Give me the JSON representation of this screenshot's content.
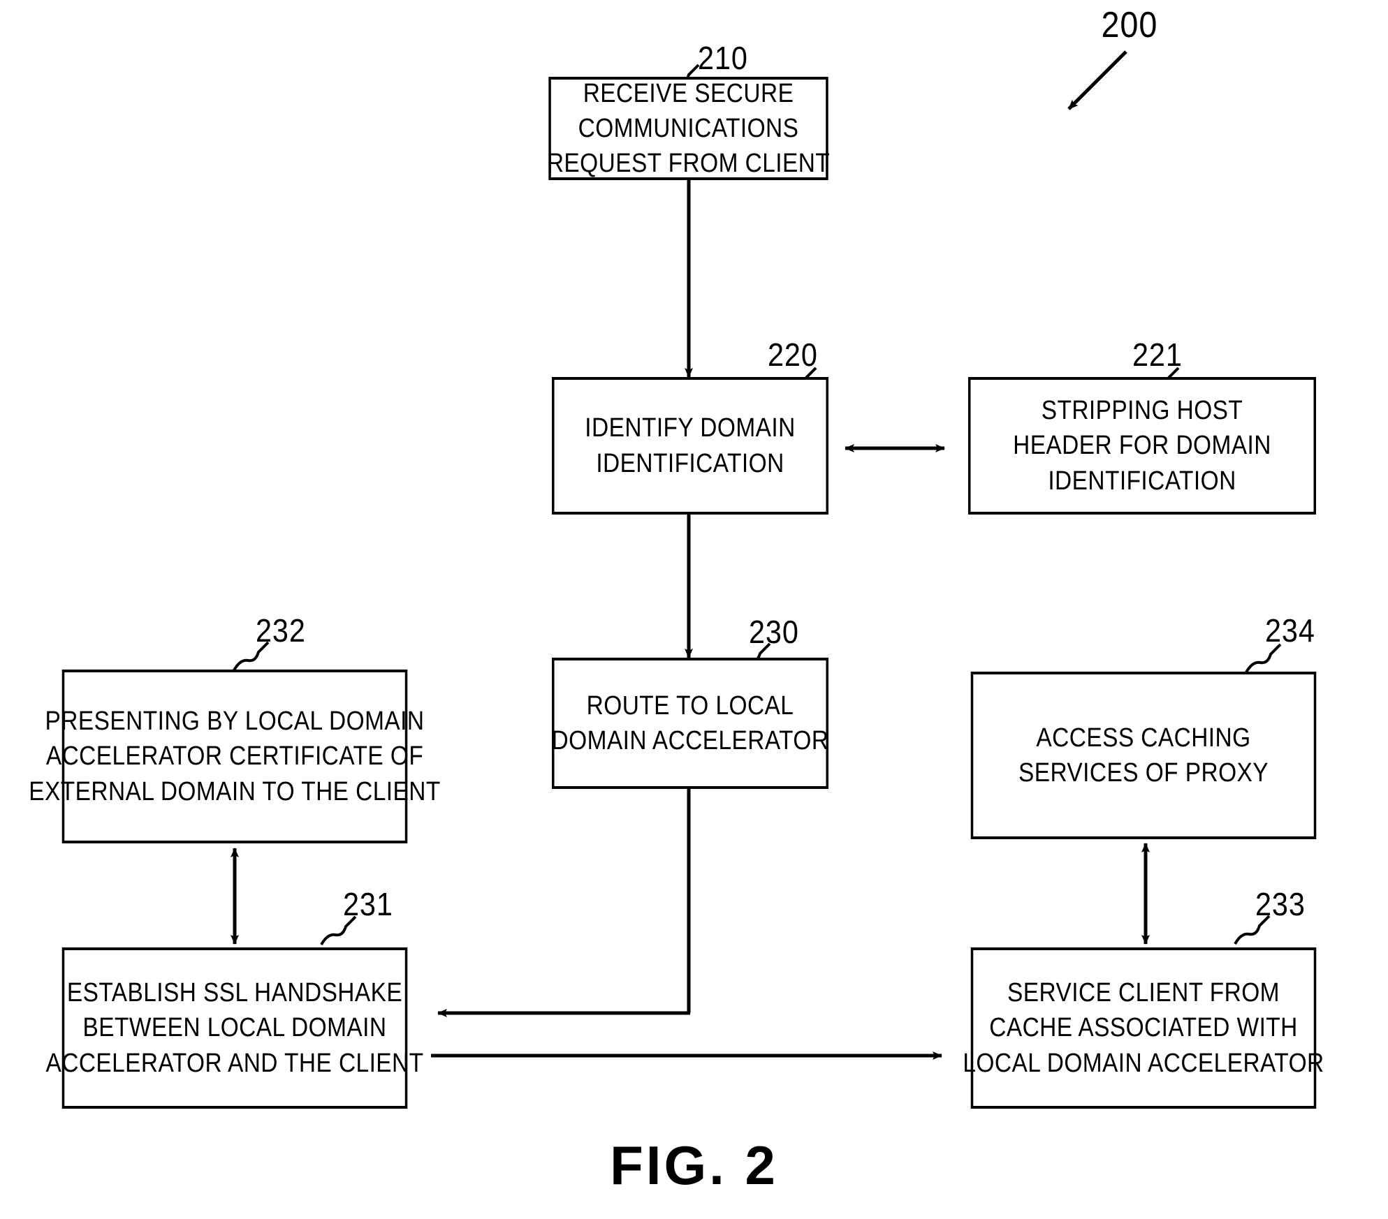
{
  "figure": {
    "caption": "FIG.  2",
    "system_numeral": "200"
  },
  "nodes": [
    {
      "id": "210",
      "numeral": "210",
      "lines": [
        "RECEIVE SECURE",
        "COMMUNICATIONS",
        "REQUEST FROM CLIENT"
      ]
    },
    {
      "id": "220",
      "numeral": "220",
      "lines": [
        "IDENTIFY DOMAIN",
        "IDENTIFICATION"
      ]
    },
    {
      "id": "221",
      "numeral": "221",
      "lines": [
        "STRIPPING HOST",
        "HEADER FOR DOMAIN",
        "IDENTIFICATION"
      ]
    },
    {
      "id": "230",
      "numeral": "230",
      "lines": [
        "ROUTE TO LOCAL",
        "DOMAIN ACCELERATOR"
      ]
    },
    {
      "id": "232",
      "numeral": "232",
      "lines": [
        "PRESENTING BY LOCAL DOMAIN",
        "ACCELERATOR CERTIFICATE OF",
        "EXTERNAL DOMAIN TO THE CLIENT"
      ]
    },
    {
      "id": "234",
      "numeral": "234",
      "lines": [
        "ACCESS CACHING",
        "SERVICES OF PROXY"
      ]
    },
    {
      "id": "231",
      "numeral": "231",
      "lines": [
        "ESTABLISH SSL HANDSHAKE",
        "BETWEEN LOCAL DOMAIN",
        "ACCELERATOR AND THE CLIENT"
      ]
    },
    {
      "id": "233",
      "numeral": "233",
      "lines": [
        "SERVICE CLIENT FROM",
        "CACHE ASSOCIATED WITH",
        "LOCAL DOMAIN ACCELERATOR"
      ]
    }
  ],
  "colors": {
    "ink": "#000000",
    "paper": "#ffffff"
  }
}
